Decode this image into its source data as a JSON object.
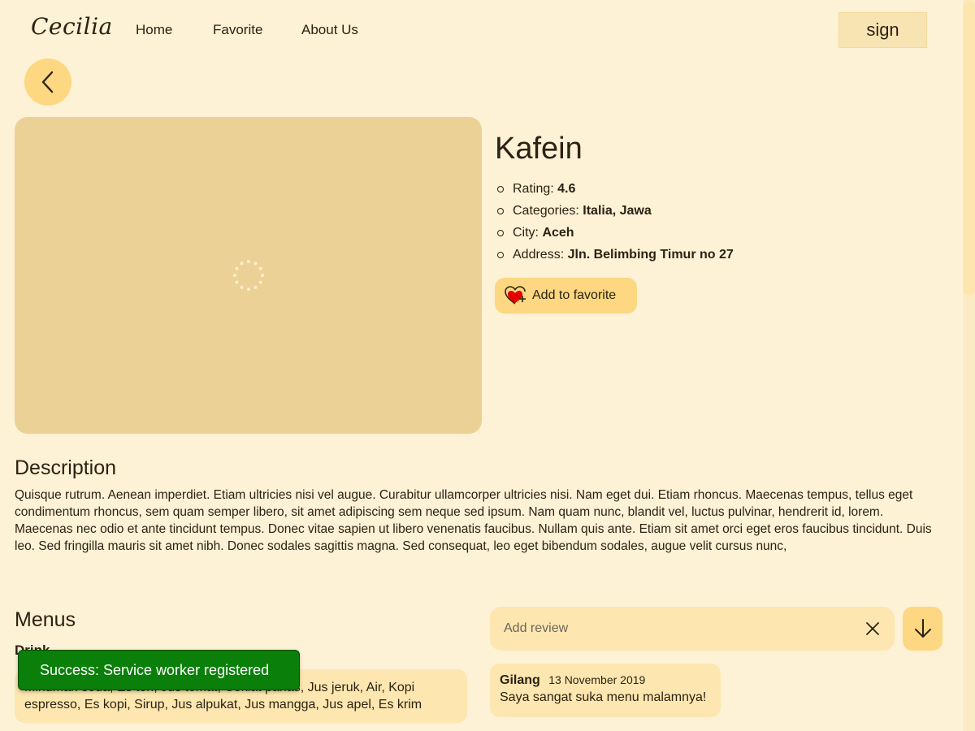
{
  "header": {
    "logo": "Cecilia",
    "nav": {
      "home": "Home",
      "favorite": "Favorite",
      "about": "About Us"
    },
    "sign_label": "sign"
  },
  "restaurant": {
    "name": "Kafein",
    "rating_label": "Rating:",
    "rating": "4.6",
    "categories_label": "Categories:",
    "categories": "Italia, Jawa",
    "city_label": "City:",
    "city": "Aceh",
    "address_label": "Address:",
    "address": "Jln. Belimbing Timur no 27",
    "favorite_label": "Add to favorite"
  },
  "description": {
    "heading": "Description",
    "text": "Quisque rutrum. Aenean imperdiet. Etiam ultricies nisi vel augue. Curabitur ullamcorper ultricies nisi. Nam eget dui. Etiam rhoncus. Maecenas tempus, tellus eget condimentum rhoncus, sem quam semper libero, sit amet adipiscing sem neque sed ipsum. Nam quam nunc, blandit vel, luctus pulvinar, hendrerit id, lorem. Maecenas nec odio et ante tincidunt tempus. Donec vitae sapien ut libero venenatis faucibus. Nullam quis ante. Etiam sit amet orci eget eros faucibus tincidunt. Duis leo. Sed fringilla mauris sit amet nibh. Donec sodales sagittis magna. Sed consequat, leo eget bibendum sodales, augue velit cursus nunc,"
  },
  "menus": {
    "heading": "Menus",
    "drink_heading": "Drink",
    "drinks": "Minuman soda, Es teh, Jus tomat, Coklat panas, Jus jeruk, Air, Kopi espresso, Es kopi, Sirup, Jus alpukat, Jus mangga, Jus apel, Es krim"
  },
  "review": {
    "placeholder": "Add review",
    "items": [
      {
        "name": "Gilang",
        "date": "13 November 2019",
        "text": "Saya sangat suka menu malamnya!"
      }
    ]
  },
  "toast": {
    "message": "Success: Service worker registered"
  },
  "colors": {
    "background": "#fdf1d6",
    "accent": "#fdd781",
    "card": "#fde6b0",
    "toast": "#0a7f0a",
    "heart": "#e50000"
  },
  "icons": {
    "back": "chevron-left-icon",
    "favorite": "heart-plus-icon",
    "clear": "close-icon",
    "submit": "arrow-down-icon",
    "loading": "spinner-icon"
  }
}
